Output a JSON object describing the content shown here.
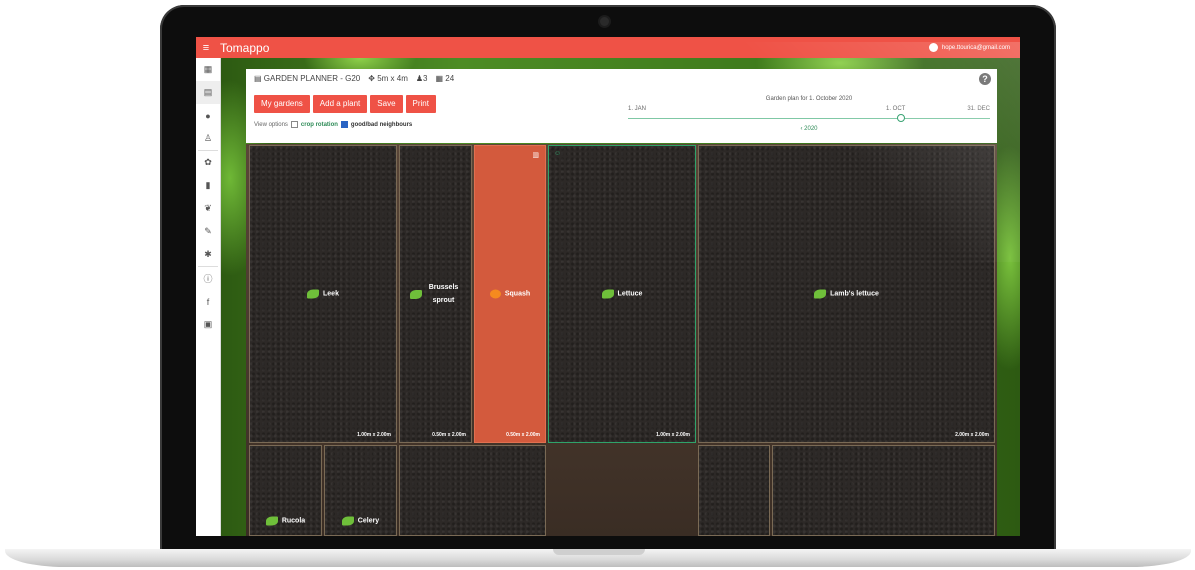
{
  "app": {
    "brand": "Tomappo",
    "user_email": "hope.ttourica@gmail.com"
  },
  "icons": [
    "menu-icon",
    "calendar-icon",
    "garden-planner-icon",
    "chat-icon",
    "microscope-icon",
    "seedling-icon",
    "book-icon",
    "sprout-icon",
    "syringe-icon",
    "bug-icon",
    "info-icon",
    "facebook-icon",
    "newsletter-icon"
  ],
  "planner": {
    "title": "GARDEN PLANNER - G20",
    "size": "5m x 4m",
    "people": "3",
    "beds": "24",
    "buttons": {
      "my_gardens": "My gardens",
      "add_plant": "Add a plant",
      "save": "Save",
      "print": "Print"
    },
    "view_options_label": "View options",
    "crop_rotation": "crop rotation",
    "neighbours": "good/bad neighbours"
  },
  "timeline": {
    "caption": "Garden plan for 1. October 2020",
    "start": "1. JAN",
    "current": "1. OCT",
    "end": "31. DEC",
    "year": "2020",
    "position": 0.75
  },
  "beds_row1": [
    {
      "plant": "Leek",
      "size": "1.00m x 2.00m"
    },
    {
      "plant": "Brussels sprout",
      "size": "0.50m x 2.00m"
    },
    {
      "plant": "Squash",
      "size": "0.50m x 2.00m",
      "selected": true
    },
    {
      "plant": "Lettuce",
      "size": "1.00m x 2.00m"
    },
    {
      "plant": "Lamb's lettuce",
      "size": "2.00m x 2.00m"
    }
  ],
  "beds_row2": [
    {
      "plant": "Rucola"
    },
    {
      "plant": "Celery"
    }
  ],
  "colors": {
    "accent": "#ef5246",
    "selected_bed": "#d35a3d",
    "good_neighbour": "#2fa36a"
  }
}
